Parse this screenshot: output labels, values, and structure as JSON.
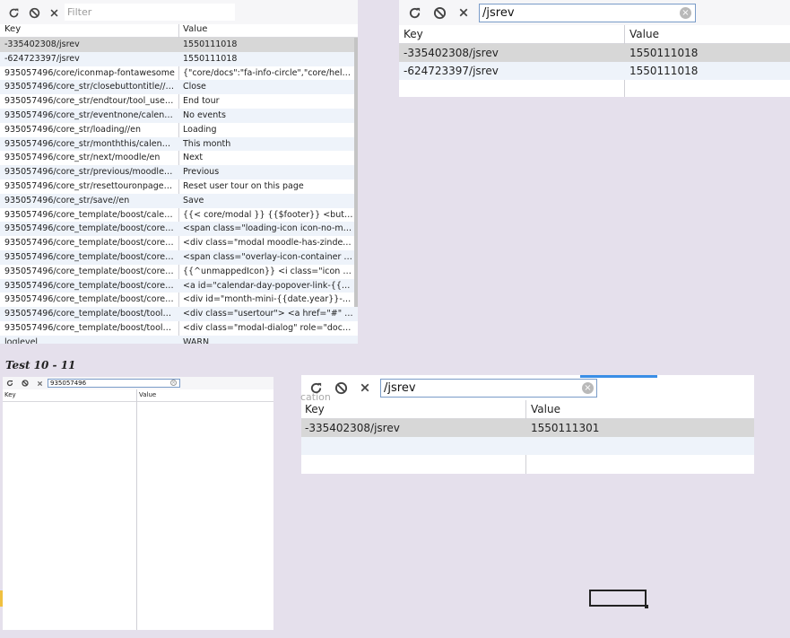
{
  "panel_top_left": {
    "filter_placeholder": "Filter",
    "columns": {
      "key": "Key",
      "value": "Value"
    },
    "rows": [
      {
        "key": "-335402308/jsrev",
        "value": "1550111018"
      },
      {
        "key": "-624723397/jsrev",
        "value": "1550111018"
      },
      {
        "key": "935057496/core/iconmap-fontawesome",
        "value": "{\"core/docs\":\"fa-info-circle\",\"core/help\":\"f..."
      },
      {
        "key": "935057496/core_str/closebuttontitle//en",
        "value": "Close"
      },
      {
        "key": "935057496/core_str/endtour/tool_userto...",
        "value": "End tour"
      },
      {
        "key": "935057496/core_str/eventnone/calendar/en",
        "value": "No events"
      },
      {
        "key": "935057496/core_str/loading//en",
        "value": "Loading"
      },
      {
        "key": "935057496/core_str/monththis/calendar/en",
        "value": "This month"
      },
      {
        "key": "935057496/core_str/next/moodle/en",
        "value": "Next"
      },
      {
        "key": "935057496/core_str/previous/moodle/en",
        "value": "Previous"
      },
      {
        "key": "935057496/core_str/resettouronpage/too...",
        "value": "Reset user tour on this page"
      },
      {
        "key": "935057496/core_str/save//en",
        "value": "Save"
      },
      {
        "key": "935057496/core_template/boost/calenda...",
        "value": "{{< core/modal }} {{$footer}} <button type..."
      },
      {
        "key": "935057496/core_template/boost/core/lo...",
        "value": "<span class=\"loading-icon icon-no-margin\"..."
      },
      {
        "key": "935057496/core_template/boost/core/m...",
        "value": "<div class=\"modal moodle-has-zindex\" dat..."
      },
      {
        "key": "935057496/core_template/boost/core/ov...",
        "value": "<span class=\"overlay-icon-container {{$hid..."
      },
      {
        "key": "935057496/core_template/boost/core/pi...",
        "value": "{{^unmappedIcon}} <i class=\"icon fa {{key}..."
      },
      {
        "key": "935057496/core_template/boost/core_ca...",
        "value": "<a id=\"calendar-day-popover-link-{{coursei..."
      },
      {
        "key": "935057496/core_template/boost/core_ca...",
        "value": "<div id=\"month-mini-{{date.year}}-{{date...."
      },
      {
        "key": "935057496/core_template/boost/tool_us...",
        "value": "<div class=\"usertour\"> <a href=\"#\" data-a..."
      },
      {
        "key": "935057496/core_template/boost/tool_us...",
        "value": "<div class=\"modal-dialog\" role=\"documen..."
      },
      {
        "key": "loglevel",
        "value": "WARN"
      }
    ]
  },
  "panel_top_right": {
    "filter_value": "/jsrev",
    "columns": {
      "key": "Key",
      "value": "Value"
    },
    "rows": [
      {
        "key": "-335402308/jsrev",
        "value": "1550111018"
      },
      {
        "key": "-624723397/jsrev",
        "value": "1550111018"
      }
    ]
  },
  "section_label": "Test 10 - 11",
  "panel_small": {
    "filter_value": "935057496",
    "columns": {
      "key": "Key",
      "value": "Value"
    }
  },
  "panel_bottom_right": {
    "ghost_text": "cation",
    "filter_value": "/jsrev",
    "columns": {
      "key": "Key",
      "value": "Value"
    },
    "rows": [
      {
        "key": "-335402308/jsrev",
        "value": "1550111301"
      }
    ]
  },
  "colors": {
    "accent": "#3a8ee6",
    "selected_row": "#d7d7d7",
    "alt_row": "#eef3fa",
    "background": "#e5e0ec"
  }
}
